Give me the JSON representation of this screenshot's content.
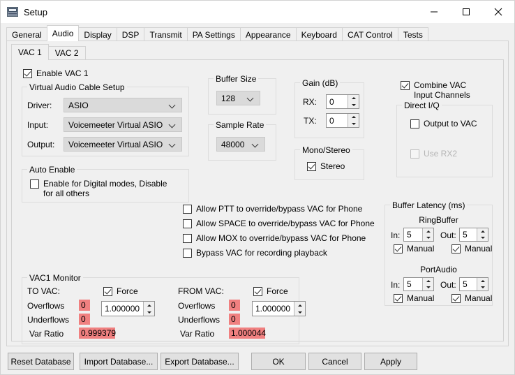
{
  "window": {
    "title": "Setup",
    "icon": "radio-device-icon",
    "controls": {
      "minimize": "minimize-icon",
      "maximize": "maximize-icon",
      "close": "close-icon"
    }
  },
  "main_tabs": {
    "selected": "Audio",
    "items": [
      "General",
      "Audio",
      "Display",
      "DSP",
      "Transmit",
      "PA Settings",
      "Appearance",
      "Keyboard",
      "CAT Control",
      "Tests"
    ]
  },
  "vac_tabs": {
    "selected": "VAC 1",
    "items": [
      "VAC 1",
      "VAC 2"
    ]
  },
  "enable_vac": {
    "label": "Enable VAC 1",
    "checked": true
  },
  "vac_setup": {
    "legend": "Virtual Audio Cable Setup",
    "driver_label": "Driver:",
    "driver_value": "ASIO",
    "input_label": "Input:",
    "input_value": "Voicemeeter Virtual ASIO",
    "output_label": "Output:",
    "output_value": "Voicemeeter Virtual ASIO"
  },
  "auto_enable": {
    "legend": "Auto Enable",
    "checkbox_label": "Enable for Digital modes, Disable for all others",
    "checked": false
  },
  "buffer_size": {
    "legend": "Buffer Size",
    "value": "128"
  },
  "sample_rate": {
    "legend": "Sample Rate",
    "value": "48000"
  },
  "gain": {
    "legend": "Gain (dB)",
    "rx_label": "RX:",
    "rx_value": "0",
    "tx_label": "TX:",
    "tx_value": "0"
  },
  "mono_stereo": {
    "legend": "Mono/Stereo",
    "stereo_label": "Stereo",
    "stereo_checked": true
  },
  "combine_vac": {
    "label": "Combine VAC Input Channels",
    "checked": true
  },
  "direct_iq": {
    "legend": "Direct I/Q",
    "output_label": "Output to VAC",
    "output_checked": false,
    "rx2_label": "Use RX2",
    "rx2_checked": false,
    "rx2_disabled": true
  },
  "override_options": [
    {
      "label": "Allow PTT to override/bypass VAC for Phone",
      "checked": false
    },
    {
      "label": "Allow SPACE to override/bypass VAC for Phone",
      "checked": false
    },
    {
      "label": "Allow MOX to override/bypass VAC for Phone",
      "checked": false
    },
    {
      "label": "Bypass VAC for recording playback",
      "checked": false
    }
  ],
  "buffer_latency": {
    "legend": "Buffer Latency (ms)",
    "ringbuffer": {
      "title": "RingBuffer",
      "in_label": "In:",
      "in_value": "5",
      "in_manual_label": "Manual",
      "in_manual_checked": true,
      "out_label": "Out:",
      "out_value": "5",
      "out_manual_label": "Manual",
      "out_manual_checked": true
    },
    "portaudio": {
      "title": "PortAudio",
      "in_label": "In:",
      "in_value": "5",
      "in_manual_label": "Manual",
      "in_manual_checked": true,
      "out_label": "Out:",
      "out_value": "5",
      "out_manual_label": "Manual",
      "out_manual_checked": true
    }
  },
  "vac_monitor": {
    "legend": "VAC1 Monitor",
    "to_vac": {
      "title": "TO VAC:",
      "overflows_label": "Overflows",
      "overflows_value": "0",
      "underflows_label": "Underflows",
      "underflows_value": "0",
      "var_ratio_label": "Var Ratio",
      "var_ratio_value": "0.999379",
      "force_label": "Force",
      "force_checked": true,
      "force_value": "1.000000"
    },
    "from_vac": {
      "title": "FROM VAC:",
      "overflows_label": "Overflows",
      "overflows_value": "0",
      "underflows_label": "Underflows",
      "underflows_value": "0",
      "var_ratio_label": "Var Ratio",
      "var_ratio_value": "1.000044",
      "force_label": "Force",
      "force_checked": true,
      "force_value": "1.000000"
    }
  },
  "buttons": {
    "reset_database": "Reset Database",
    "import_database": "Import Database...",
    "export_database": "Export Database...",
    "ok": "OK",
    "cancel": "Cancel",
    "apply": "Apply"
  },
  "colors": {
    "window_bg": "#f0f0f0",
    "titlebar_bg": "#ffffff",
    "alert_highlight": "#f08080",
    "group_border": "#dcdcdc",
    "combo_bg": "#dadada"
  }
}
